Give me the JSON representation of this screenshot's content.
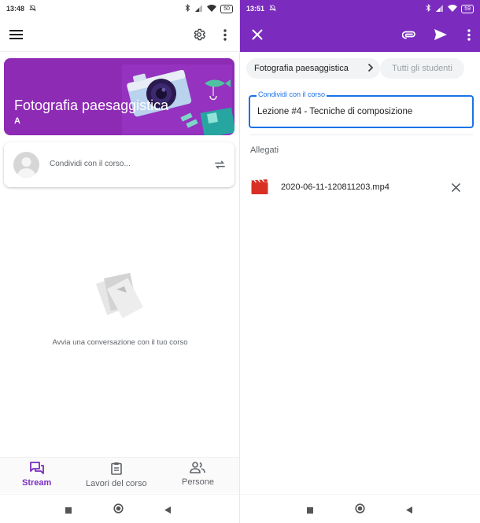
{
  "left": {
    "status": {
      "time": "13:48",
      "battery": "50"
    },
    "course": {
      "title": "Fotografia paesaggistica",
      "section": "A"
    },
    "share": {
      "placeholder": "Condividi con il corso..."
    },
    "empty_message": "Avvia una conversazione con il tuo corso",
    "nav": [
      {
        "label": "Stream",
        "icon": "stream-icon",
        "active": true
      },
      {
        "label": "Lavori del corso",
        "icon": "classwork-icon",
        "active": false
      },
      {
        "label": "Persone",
        "icon": "people-icon",
        "active": false
      }
    ]
  },
  "right": {
    "status": {
      "time": "13:51",
      "battery": "59"
    },
    "chips": {
      "course": "Fotografia paesaggistica",
      "students": "Tutti gli studenti"
    },
    "field": {
      "label": "Condividi con il corso",
      "value": "Lezione #4 - Tecniche di composizione"
    },
    "attachments": {
      "heading": "Allegati",
      "items": [
        {
          "name": "2020-06-11-120811203.mp4",
          "icon": "video-file-icon"
        }
      ]
    }
  },
  "colors": {
    "accent": "#7b2cbf",
    "banner": "#8e2bb5",
    "focus": "#1a73e8",
    "video_icon": "#d93025"
  }
}
